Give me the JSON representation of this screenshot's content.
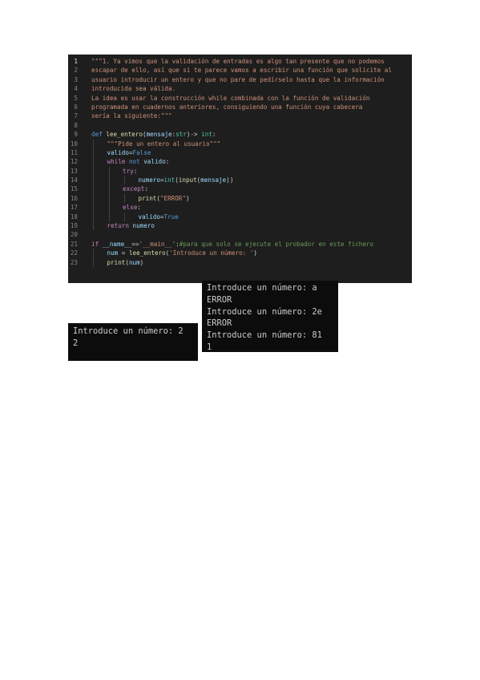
{
  "code": {
    "lines": [
      {
        "n": "1",
        "active": true,
        "indent": 0,
        "tokens": [
          {
            "t": "\"\"\"1. Ya vimos que la validación de entradas es algo tan presente que no podemos",
            "c": "str"
          }
        ]
      },
      {
        "n": "2",
        "indent": 0,
        "tokens": [
          {
            "t": "escapar de ello, así que si te parece vamos a escribir una función que solicite al",
            "c": "str"
          }
        ]
      },
      {
        "n": "3",
        "indent": 0,
        "tokens": [
          {
            "t": "usuario introducir un entero y que no pare de pedírselo hasta que la información",
            "c": "str"
          }
        ]
      },
      {
        "n": "4",
        "indent": 0,
        "tokens": [
          {
            "t": "introducida sea válida.",
            "c": "str"
          }
        ]
      },
      {
        "n": "5",
        "indent": 0,
        "tokens": [
          {
            "t": "La idea es usar la construcción while combinada con la función de validación",
            "c": "str"
          }
        ]
      },
      {
        "n": "6",
        "indent": 0,
        "tokens": [
          {
            "t": "programada en cuadernos anteriores, consiguiendo una función cuya cabecera",
            "c": "str"
          }
        ]
      },
      {
        "n": "7",
        "indent": 0,
        "tokens": [
          {
            "t": "sería la siguiente:\"\"\"",
            "c": "str"
          }
        ]
      },
      {
        "n": "8",
        "indent": 0,
        "tokens": []
      },
      {
        "n": "9",
        "indent": 0,
        "tokens": [
          {
            "t": "def ",
            "c": "kw"
          },
          {
            "t": "lee_entero",
            "c": "fn"
          },
          {
            "t": "(",
            "c": "op"
          },
          {
            "t": "mensaje",
            "c": "var"
          },
          {
            "t": ":",
            "c": "op"
          },
          {
            "t": "str",
            "c": "type"
          },
          {
            "t": ")-> ",
            "c": "op"
          },
          {
            "t": "int",
            "c": "type"
          },
          {
            "t": ":",
            "c": "op"
          }
        ]
      },
      {
        "n": "10",
        "indent": 1,
        "tokens": [
          {
            "t": "\"\"\"Pide un entero al usuario\"\"\"",
            "c": "str"
          }
        ]
      },
      {
        "n": "11",
        "indent": 1,
        "tokens": [
          {
            "t": "valido",
            "c": "var"
          },
          {
            "t": "=",
            "c": "op"
          },
          {
            "t": "False",
            "c": "kw"
          }
        ]
      },
      {
        "n": "12",
        "indent": 1,
        "tokens": [
          {
            "t": "while ",
            "c": "ctrl"
          },
          {
            "t": "not ",
            "c": "kw"
          },
          {
            "t": "valido",
            "c": "var"
          },
          {
            "t": ":",
            "c": "op"
          }
        ]
      },
      {
        "n": "13",
        "indent": 2,
        "tokens": [
          {
            "t": "try",
            "c": "ctrl"
          },
          {
            "t": ":",
            "c": "op"
          }
        ]
      },
      {
        "n": "14",
        "indent": 3,
        "tokens": [
          {
            "t": "numero",
            "c": "var"
          },
          {
            "t": "=",
            "c": "op"
          },
          {
            "t": "int",
            "c": "type"
          },
          {
            "t": "(",
            "c": "op"
          },
          {
            "t": "input",
            "c": "fn"
          },
          {
            "t": "(",
            "c": "op"
          },
          {
            "t": "mensaje",
            "c": "var"
          },
          {
            "t": "))",
            "c": "op"
          }
        ]
      },
      {
        "n": "15",
        "indent": 2,
        "tokens": [
          {
            "t": "except",
            "c": "ctrl"
          },
          {
            "t": ":",
            "c": "op"
          }
        ]
      },
      {
        "n": "16",
        "indent": 3,
        "tokens": [
          {
            "t": "print",
            "c": "fn"
          },
          {
            "t": "(",
            "c": "op"
          },
          {
            "t": "\"ERROR\"",
            "c": "str"
          },
          {
            "t": ")",
            "c": "op"
          }
        ]
      },
      {
        "n": "17",
        "indent": 2,
        "tokens": [
          {
            "t": "else",
            "c": "ctrl"
          },
          {
            "t": ":",
            "c": "op"
          }
        ]
      },
      {
        "n": "18",
        "indent": 3,
        "tokens": [
          {
            "t": "valido",
            "c": "var"
          },
          {
            "t": "=",
            "c": "op"
          },
          {
            "t": "True",
            "c": "kw"
          }
        ]
      },
      {
        "n": "19",
        "indent": 1,
        "tokens": [
          {
            "t": "return ",
            "c": "ctrl"
          },
          {
            "t": "numero",
            "c": "var"
          }
        ]
      },
      {
        "n": "20",
        "indent": 0,
        "tokens": []
      },
      {
        "n": "21",
        "indent": 0,
        "tokens": [
          {
            "t": "if ",
            "c": "ctrl"
          },
          {
            "t": "__name__",
            "c": "var"
          },
          {
            "t": "==",
            "c": "op"
          },
          {
            "t": "'__main__'",
            "c": "str"
          },
          {
            "t": ":",
            "c": "op"
          },
          {
            "t": "#para que solo se ejecute el probador en este fichero",
            "c": "cmt"
          }
        ]
      },
      {
        "n": "22",
        "indent": 1,
        "tokens": [
          {
            "t": "num",
            "c": "var"
          },
          {
            "t": " = ",
            "c": "op"
          },
          {
            "t": "lee_entero",
            "c": "fn"
          },
          {
            "t": "(",
            "c": "op"
          },
          {
            "t": "'Introduce un número: '",
            "c": "str"
          },
          {
            "t": ")",
            "c": "op"
          }
        ]
      },
      {
        "n": "23",
        "indent": 1,
        "tokens": [
          {
            "t": "print",
            "c": "fn"
          },
          {
            "t": "(",
            "c": "op"
          },
          {
            "t": "num",
            "c": "var"
          },
          {
            "t": ")",
            "c": "op"
          }
        ]
      }
    ]
  },
  "terminal_right": {
    "lines": [
      "Introduce un número: a",
      "ERROR",
      "Introduce un número: 2e",
      "ERROR",
      "Introduce un número: 81",
      "1"
    ]
  },
  "terminal_left": {
    "lines": [
      "Introduce un número: 2",
      "2"
    ]
  },
  "colors": {
    "editor_background": "#1e1e1e",
    "terminal_background": "#0c0c0c",
    "string": "#ce9178",
    "keyword": "#569cd6",
    "control": "#c586c0",
    "function": "#dcdcaa",
    "variable": "#9cdcfe",
    "type": "#4ec9b0",
    "comment": "#6a9955"
  }
}
